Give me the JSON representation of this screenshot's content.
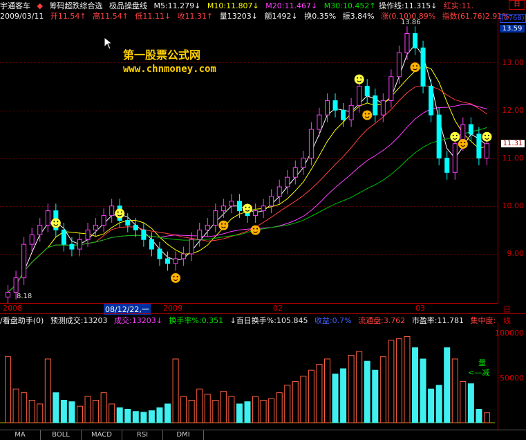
{
  "header": {
    "app_name": "宇通客车",
    "indicator_name": "筹码超跌综合选",
    "sub_indicator": "极品操盘线",
    "ma5": "M5:11.279↓",
    "ma10": "M10:11.807↓",
    "ma20": "M20:11.467↓",
    "ma30": "M30:10.452↑",
    "operate_line": "操作线:11.315↓",
    "red_label": "红实:11.",
    "close_btn": "日"
  },
  "quote": {
    "date": "2009/03/11",
    "open": "开11.54↑",
    "high": "高11.54↑",
    "low": "低11.11↓",
    "close": "收11.31↑",
    "volume": "量13203↓",
    "amount": "额1492↓",
    "turnover": "换0.35%",
    "amplitude": "振3.84%",
    "change": "涨(0.10)0.89%",
    "index": "指数(61.76)2.91%"
  },
  "watermark": {
    "title": "第一股票公式网",
    "url": "www.chnmoney.com"
  },
  "price_axis": {
    "code_box": "(2768)",
    "top_value": "13.59",
    "labels": [
      "13.00",
      "12.00",
      "11.00",
      "10.00",
      "9.00"
    ],
    "current_tag": "11.31"
  },
  "annotations": {
    "high_marker": "13.86",
    "low_marker": "8.18"
  },
  "date_axis": {
    "labels": [
      "2008",
      "2009",
      "02",
      "03"
    ],
    "cursor_date": "08/12/22,一",
    "period": "日线"
  },
  "volume_panel": {
    "title": "/看盘助手(0)",
    "forecast": "预测成交:13203",
    "volume": "成交:13203↓",
    "turnover_rate": "换手率%:0.351",
    "hundred_day": "↓百日换手%:105.845",
    "income": "收益:0.7%",
    "float_cap": "流通盘:3.762",
    "pe": "市盈率:11.781",
    "concentration": "集中度:",
    "axis_labels": [
      "100000",
      "50000"
    ],
    "legend_up": "量",
    "legend_down": "<—减"
  },
  "tabs": [
    "MA",
    "BOLL",
    "MACD",
    "RSI",
    "DMI"
  ],
  "chart_data": {
    "type": "bar",
    "title": "宇通客车 日线",
    "x_range": [
      "2008",
      "2009-03"
    ],
    "ylim": [
      8.0,
      13.9
    ],
    "price_high": 13.86,
    "price_low": 8.18,
    "series": [
      {
        "name": "M5",
        "last": 11.279
      },
      {
        "name": "M10",
        "last": 11.807
      },
      {
        "name": "M20",
        "last": 11.467
      },
      {
        "name": "M30",
        "last": 10.452
      }
    ],
    "closes": [
      8.2,
      8.5,
      9.2,
      9.4,
      9.6,
      9.9,
      9.5,
      9.2,
      9.1,
      9.3,
      9.5,
      9.6,
      9.8,
      10.0,
      9.7,
      9.6,
      9.5,
      9.3,
      9.1,
      8.9,
      8.8,
      8.9,
      9.0,
      9.3,
      9.5,
      9.6,
      9.9,
      10.0,
      10.1,
      9.9,
      9.8,
      9.9,
      10.0,
      10.2,
      10.4,
      10.6,
      10.8,
      11.0,
      11.6,
      11.9,
      12.2,
      12.0,
      11.8,
      12.1,
      12.5,
      12.3,
      11.9,
      12.2,
      12.7,
      13.2,
      13.6,
      13.3,
      12.5,
      11.9,
      11.0,
      10.7,
      11.3,
      11.7,
      11.5,
      11.0,
      11.3
    ],
    "volumes": [
      88000,
      45000,
      40000,
      30000,
      25000,
      85000,
      40000,
      30000,
      28000,
      22000,
      35000,
      30000,
      40000,
      25000,
      20000,
      18000,
      15000,
      14000,
      16000,
      20000,
      25000,
      85000,
      35000,
      30000,
      45000,
      38000,
      30000,
      42000,
      35000,
      25000,
      28000,
      35000,
      30000,
      32000,
      40000,
      50000,
      55000,
      62000,
      70000,
      78000,
      85000,
      65000,
      72000,
      90000,
      95000,
      82000,
      70000,
      88000,
      110000,
      112000,
      115000,
      100000,
      85000,
      45000,
      50000,
      100000,
      85000,
      55000,
      52000,
      18000,
      13203
    ]
  }
}
